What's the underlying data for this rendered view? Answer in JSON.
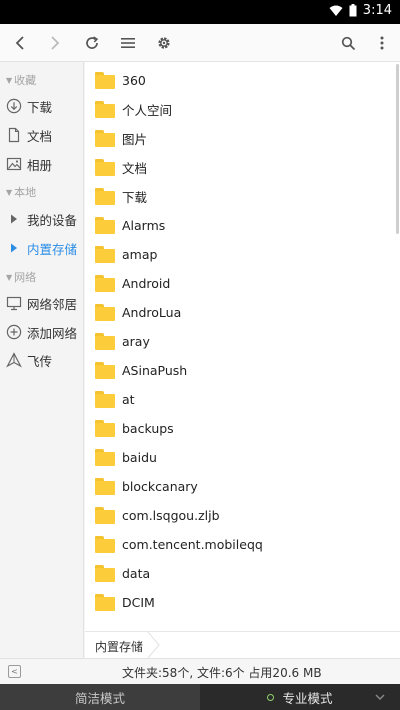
{
  "statusbar": {
    "time": "3:14"
  },
  "toolbar": {
    "icons": [
      "back-icon",
      "forward-icon",
      "refresh-icon",
      "list-view-icon",
      "settings-icon",
      "search-icon",
      "more-icon"
    ]
  },
  "sidebar": {
    "favorites_header": "收藏",
    "favorites": [
      {
        "label": "下载",
        "icon": "download-icon"
      },
      {
        "label": "文档",
        "icon": "document-icon"
      },
      {
        "label": "相册",
        "icon": "image-icon"
      }
    ],
    "local_header": "本地",
    "local": [
      {
        "label": "我的设备",
        "active": false
      },
      {
        "label": "内置存储",
        "active": true
      }
    ],
    "network_header": "网络",
    "network": [
      {
        "label": "网络邻居",
        "icon": "network-icon"
      },
      {
        "label": "添加网络",
        "icon": "add-icon"
      },
      {
        "label": "飞传",
        "icon": "send-icon"
      }
    ]
  },
  "files": [
    "360",
    "个人空间",
    "图片",
    "文档",
    "下载",
    "Alarms",
    "amap",
    "Android",
    "AndroLua",
    "aray",
    "ASinaPush",
    "at",
    "backups",
    "baidu",
    "blockcanary",
    "com.lsqgou.zljb",
    "com.tencent.mobileqq",
    "data",
    "DCIM"
  ],
  "breadcrumb": {
    "current": "内置存储"
  },
  "info": {
    "summary": "文件夹:58个, 文件:6个 占用20.6 MB"
  },
  "modes": {
    "simple": "简洁模式",
    "pro": "专业模式"
  },
  "colors": {
    "accent": "#2b8de6",
    "folder": "#fccc3b",
    "mode_indicator": "#8cd46a"
  }
}
